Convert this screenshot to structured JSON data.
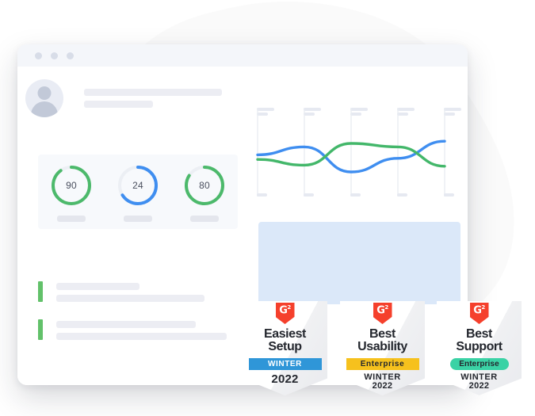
{
  "window": {
    "titlebar_dots": [
      "dot-red",
      "dot-yellow",
      "dot-green"
    ],
    "profile": {
      "avatar": "user-avatar-icon",
      "line1": "",
      "line2": ""
    }
  },
  "gauges": [
    {
      "value": "90",
      "percent": 90,
      "color": "#4cb96b",
      "track": "#eceff4"
    },
    {
      "value": "24",
      "percent": 66,
      "color": "#3f8ef0",
      "track": "#eceff4"
    },
    {
      "value": "80",
      "percent": 84,
      "color": "#4cb96b",
      "track": "#eceff4"
    }
  ],
  "chart_data": {
    "type": "line",
    "title": "",
    "xlabel": "",
    "ylabel": "",
    "grid": true,
    "legend": "none",
    "x": [
      0,
      1,
      2,
      3,
      4
    ],
    "xlim": [
      0,
      4
    ],
    "ylim": [
      0,
      100
    ],
    "series": [
      {
        "name": "series-blue",
        "color": "#3f8ef0",
        "values": [
          48,
          62,
          18,
          42,
          72
        ]
      },
      {
        "name": "series-green",
        "color": "#43b76a",
        "values": [
          40,
          30,
          68,
          62,
          28
        ]
      }
    ],
    "tick_labels": [
      "",
      "",
      "",
      "",
      ""
    ]
  },
  "blue_block": {
    "color": "#dbe8f9"
  },
  "list_rows": [
    {
      "accent": "#62c16a",
      "line1_width": 105,
      "line2_width": 187
    },
    {
      "accent": "#62c16a",
      "line1_width": 176,
      "line2_width": 215
    }
  ],
  "badges": [
    {
      "logo": "g2-logo-icon",
      "logo_text": "G",
      "logo_sup": "2",
      "title_lines": [
        "Easiest",
        "Setup"
      ],
      "ribbon_text": "WINTER",
      "ribbon_color": "#2f96d8",
      "ribbon_text_color": "#ffffff",
      "ribbon_style": "banner",
      "period_lines": [
        "2022"
      ],
      "period_size": "big"
    },
    {
      "logo": "g2-logo-icon",
      "logo_text": "G",
      "logo_sup": "2",
      "title_lines": [
        "Best",
        "Usability"
      ],
      "ribbon_text": "Enterprise",
      "ribbon_color": "#f6c11d",
      "ribbon_text_color": "#24272e",
      "ribbon_style": "banner",
      "period_lines": [
        "WINTER",
        "2022"
      ],
      "period_size": "small"
    },
    {
      "logo": "g2-logo-icon",
      "logo_text": "G",
      "logo_sup": "2",
      "title_lines": [
        "Best",
        "Support"
      ],
      "ribbon_text": "Enterprise",
      "ribbon_color": "#3ad2a5",
      "ribbon_text_color": "#24272e",
      "ribbon_style": "pill",
      "period_lines": [
        "WINTER",
        "2022"
      ],
      "period_size": "small"
    }
  ],
  "colors": {
    "background_blob": "#fafafa",
    "window_bg": "#ffffff",
    "titlebar": "#f4f6fa",
    "skeleton": "#ecedf3",
    "card_bg": "#f7f9fc",
    "g2_red": "#f5402c"
  }
}
